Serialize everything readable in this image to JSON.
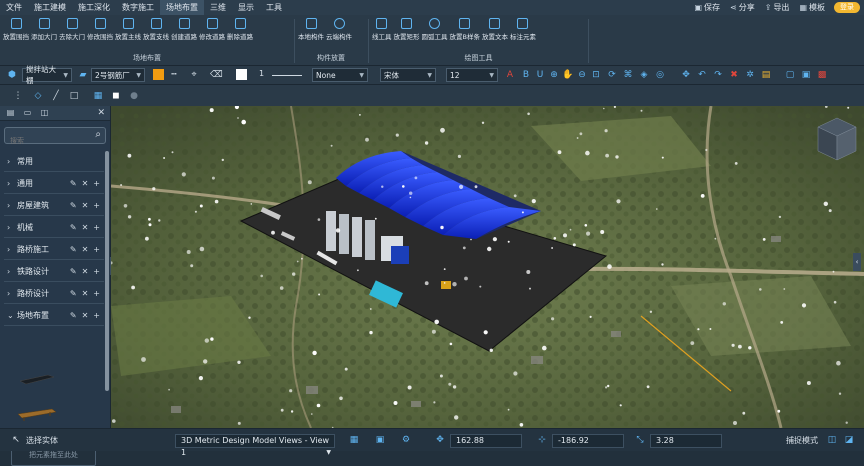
{
  "menu": {
    "items": [
      "文件",
      "施工建模",
      "施工深化",
      "数字施工",
      "场地布置",
      "三维",
      "显示",
      "工具"
    ],
    "active_index": 4,
    "right": {
      "save": "保存",
      "share": "分享",
      "export": "导出",
      "template": "模板",
      "login": "登录"
    }
  },
  "ribbon": {
    "group1": {
      "label": "场地布置",
      "buttons": [
        "放置围挡",
        "添加大门",
        "去除大门",
        "修改围挡",
        "放置主线",
        "放置支线",
        "创建道路",
        "修改道路",
        "删除道路"
      ]
    },
    "group2": {
      "label": "构件放置",
      "buttons": [
        "本地构件",
        "云端构件"
      ]
    },
    "group3": {
      "label": "绘图工具",
      "buttons": [
        "线工具",
        "放置矩形",
        "圆弧工具",
        "放置B样条",
        "放置文本",
        "标注元素"
      ]
    }
  },
  "toolbar2": {
    "layer": "搅拌站大棚",
    "block": "2号钢筋厂",
    "line_width": "1",
    "fill": "None",
    "font": "宋体",
    "font_size": "12",
    "accent_color": "#f29c11"
  },
  "panel": {
    "search_placeholder": "搜索",
    "categories": [
      {
        "label": "常用",
        "actions": false
      },
      {
        "label": "通用",
        "actions": true
      },
      {
        "label": "房屋建筑",
        "actions": true
      },
      {
        "label": "机械",
        "actions": true
      },
      {
        "label": "路桥施工",
        "actions": true
      },
      {
        "label": "铁路设计",
        "actions": true
      },
      {
        "label": "路桥设计",
        "actions": true
      },
      {
        "label": "场地布置",
        "actions": true,
        "expanded": true
      }
    ],
    "dropzone": "把元素拖至此处"
  },
  "status": {
    "select_label": "选择实体",
    "view_name": "3D Metric Design Model Views - View 1",
    "x": "162.88",
    "y": "-186.92",
    "z": "3.28",
    "snap_label": "捕捉模式"
  }
}
